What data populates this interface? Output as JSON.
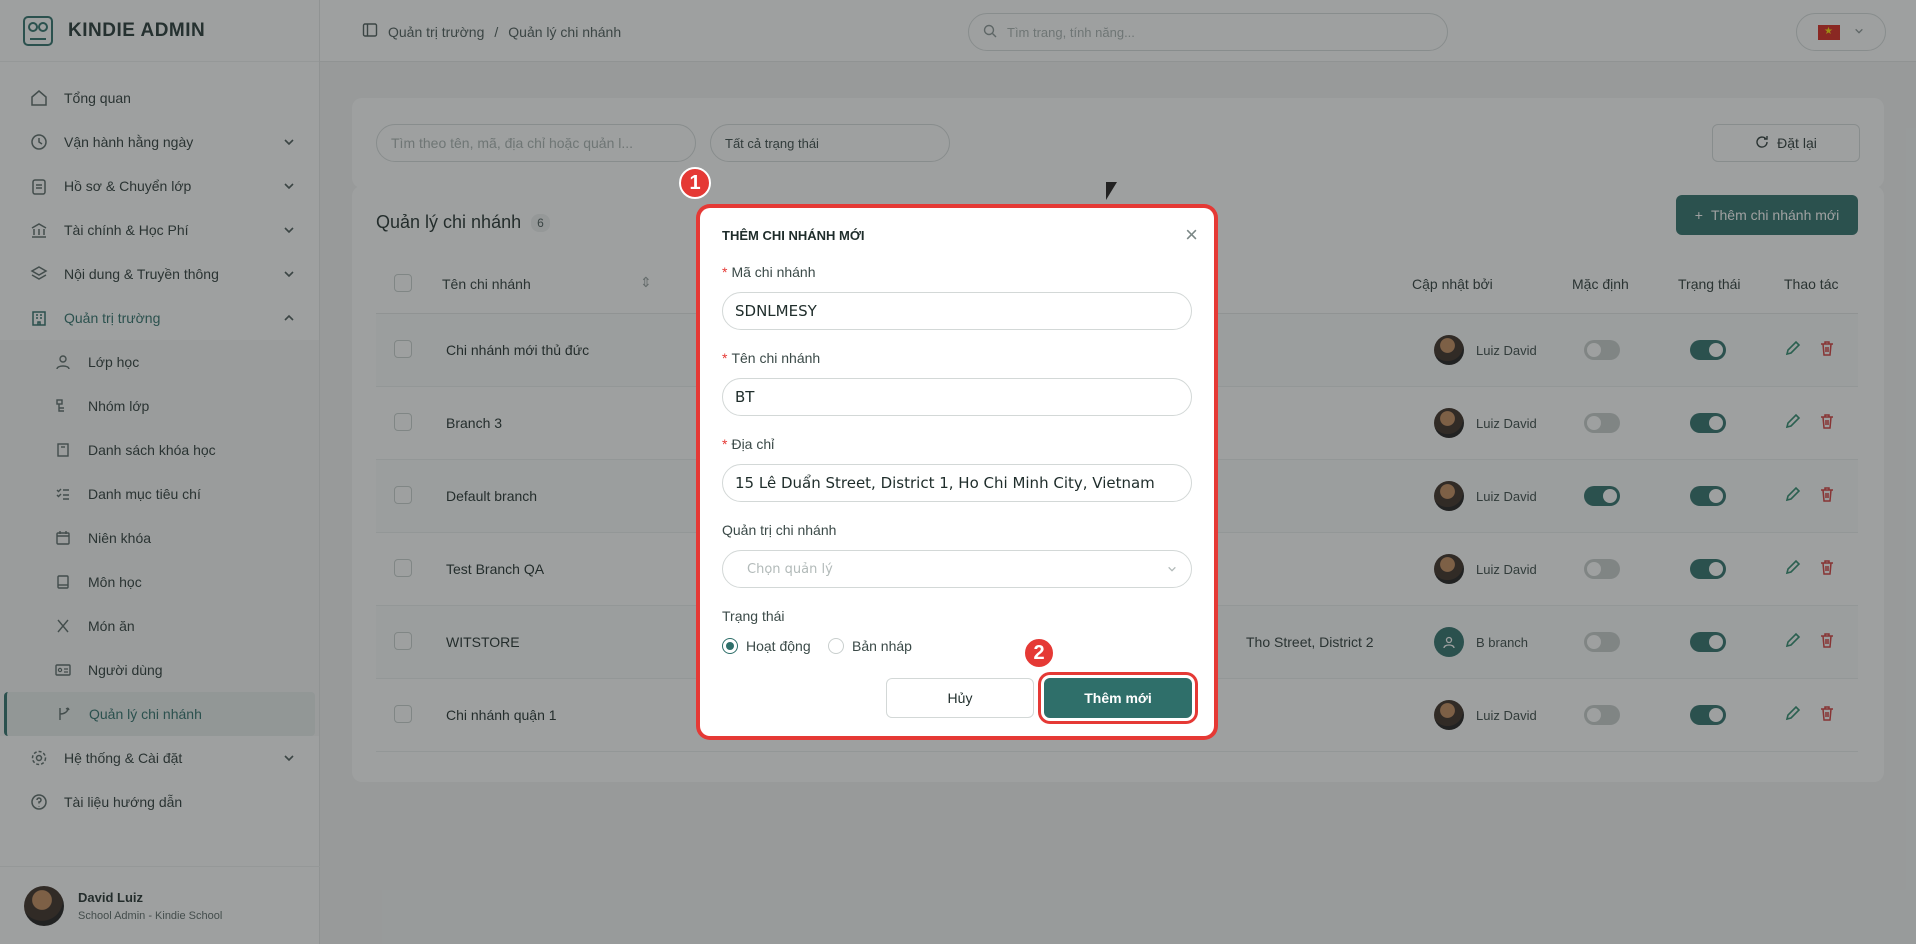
{
  "brand": {
    "name": "KINDIE ADMIN"
  },
  "sidebar": {
    "items": [
      {
        "label": "Tổng quan",
        "icon": "home-icon"
      },
      {
        "label": "Vận hành hằng ngày",
        "icon": "clock-icon"
      },
      {
        "label": "Hồ sơ & Chuyển lớp",
        "icon": "clipboard-icon"
      },
      {
        "label": "Tài chính & Học Phí",
        "icon": "bank-icon"
      },
      {
        "label": "Nội dung & Truyền thông",
        "icon": "layers-icon"
      },
      {
        "label": "Quản trị trường",
        "icon": "building-icon"
      }
    ],
    "sub_items": [
      {
        "label": "Lớp học"
      },
      {
        "label": "Nhóm lớp"
      },
      {
        "label": "Danh sách khóa học"
      },
      {
        "label": "Danh mục tiêu chí"
      },
      {
        "label": "Niên khóa"
      },
      {
        "label": "Môn học"
      },
      {
        "label": "Món ăn"
      },
      {
        "label": "Người dùng"
      },
      {
        "label": "Quản lý chi nhánh"
      }
    ],
    "bottom_items": [
      {
        "label": "Hệ thống & Cài đặt"
      },
      {
        "label": "Tài liệu hướng dẫn"
      }
    ],
    "user": {
      "name": "David Luiz",
      "role": "School Admin - Kindie School"
    }
  },
  "topbar": {
    "breadcrumb": [
      "Quản trị trường",
      "/",
      "Quản lý chi nhánh"
    ],
    "search_placeholder": "Tìm trang, tính năng..."
  },
  "filters": {
    "search_placeholder": "Tìm theo tên, mã, địa chỉ hoặc quản l...",
    "status_select": "Tất cả trạng thái",
    "reset_label": "Đặt lại"
  },
  "card": {
    "title": "Quản lý chi nhánh",
    "count": "6",
    "add_label": "Thêm chi nhánh mới"
  },
  "table": {
    "headers": {
      "name": "Tên chi nhánh",
      "updated_by": "Cập nhật bởi",
      "default": "Mặc định",
      "status": "Trạng thái",
      "actions": "Thao tác"
    },
    "rows": [
      {
        "name": "Chi nhánh mới thủ đức",
        "address": "",
        "updated_by": "Luiz David",
        "is_default": false,
        "active": true
      },
      {
        "name": "Branch 3",
        "address": "",
        "updated_by": "Luiz David",
        "is_default": false,
        "active": true
      },
      {
        "name": "Default branch",
        "address": "",
        "updated_by": "Luiz David",
        "is_default": true,
        "active": true
      },
      {
        "name": "Test Branch QA",
        "address": "",
        "updated_by": "Luiz David",
        "is_default": false,
        "active": true
      },
      {
        "name": "WITSTORE",
        "address": "Tho Street, District 2",
        "updated_by": "B branch",
        "is_default": false,
        "active": true
      },
      {
        "name": "Chi nhánh quận 1",
        "address": "",
        "updated_by": "Luiz David",
        "is_default": false,
        "active": true
      }
    ]
  },
  "modal": {
    "title": "THÊM CHI NHÁNH MỚI",
    "code_label": "Mã chi nhánh",
    "code_value": "SDNLMESY",
    "name_label": "Tên chi nhánh",
    "name_value": "BT",
    "address_label": "Địa chỉ",
    "address_value": "15 Lê Duẩn Street, District 1, Ho Chi Minh City, Vietnam",
    "manager_label": "Quản trị chi nhánh",
    "manager_placeholder": "Chọn quản lý",
    "status_label": "Trạng thái",
    "status_options": [
      "Hoạt động",
      "Bản nháp"
    ],
    "status_selected": "Hoạt động",
    "cancel_label": "Hủy",
    "submit_label": "Thêm mới"
  },
  "markers": [
    "1",
    "2"
  ],
  "colors": {
    "accent": "#2f6f6a",
    "highlight": "#e53935"
  }
}
